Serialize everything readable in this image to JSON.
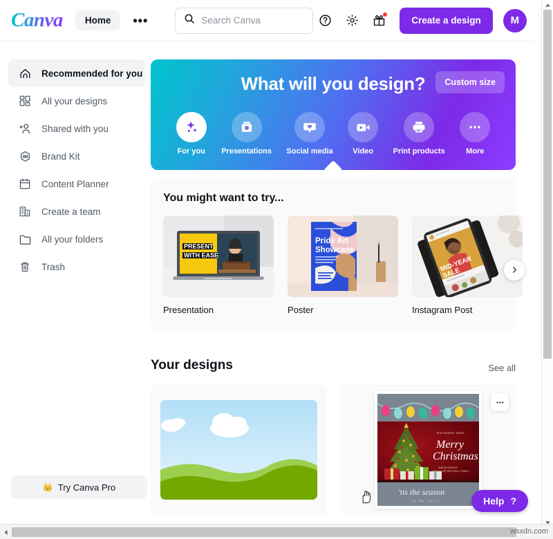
{
  "app": {
    "brand": "Canva",
    "avatar_initial": "M"
  },
  "header": {
    "home_label": "Home",
    "more_label": "•••",
    "search": {
      "placeholder": "Search Canva",
      "value": "",
      "icon": "search-icon"
    },
    "help_icon": "question-circle-icon",
    "settings_icon": "gear-icon",
    "gift_icon": "gift-icon",
    "create_button": "Create a design",
    "accent_color": "#7d2ae8"
  },
  "sidebar": {
    "items": [
      {
        "label": "Recommended for you",
        "icon": "home-icon",
        "active": true
      },
      {
        "label": "All your designs",
        "icon": "grid-icon",
        "active": false
      },
      {
        "label": "Shared with you",
        "icon": "add-person-icon",
        "active": false
      },
      {
        "label": "Brand Kit",
        "icon": "brand-hexagon-icon",
        "active": false
      },
      {
        "label": "Content Planner",
        "icon": "calendar-icon",
        "active": false
      },
      {
        "label": "Create a team",
        "icon": "building-icon",
        "active": false
      },
      {
        "label": "All your folders",
        "icon": "folder-icon",
        "active": false
      },
      {
        "label": "Trash",
        "icon": "trash-icon",
        "active": false
      }
    ],
    "pro_button": {
      "label": "Try Canva Pro",
      "icon": "crown-icon"
    }
  },
  "hero": {
    "title": "What will you design?",
    "custom_size_label": "Custom size",
    "gradient_from": "#00c4cc",
    "gradient_to": "#8b3dff",
    "categories": [
      {
        "label": "For you",
        "icon": "sparkle-icon",
        "selected": true
      },
      {
        "label": "Presentations",
        "icon": "presentation-icon",
        "selected": false
      },
      {
        "label": "Social media",
        "icon": "heart-bubble-icon",
        "selected": false
      },
      {
        "label": "Video",
        "icon": "video-camera-icon",
        "selected": false
      },
      {
        "label": "Print products",
        "icon": "printer-icon",
        "selected": false
      },
      {
        "label": "More",
        "icon": "ellipsis-icon",
        "selected": false
      }
    ]
  },
  "try_section": {
    "title": "You might want to try...",
    "next_icon": "chevron-right-icon",
    "cards": [
      {
        "name": "Presentation",
        "thumb_text_1": "PRESENT",
        "thumb_text_2": "WITH EASE"
      },
      {
        "name": "Poster",
        "thumb_text_1": "Pride Art",
        "thumb_text_2": "Showcase"
      },
      {
        "name": "Instagram Post",
        "thumb_text_1": "MID-YEAR",
        "thumb_text_2": "SALE"
      }
    ]
  },
  "designs_section": {
    "title": "Your designs",
    "see_all_label": "See all",
    "more_icon": "ellipsis-icon",
    "cards": [
      {
        "kind": "landscape",
        "name": ""
      },
      {
        "kind": "christmas-card",
        "date": "December 2021",
        "line1": "Merry",
        "line2": "Christmas!",
        "sub1": "WARM WISHES",
        "sub2": "FROM THE MITCHELL FAMILY",
        "footer1": "'tis the season",
        "footer2": "TO BE JOLLY"
      }
    ]
  },
  "help_fab": {
    "label": "Help",
    "icon": "question-mark-icon"
  },
  "watermark": {
    "text": "wsxdn.com"
  },
  "scrollbars": {
    "vertical_icon": "triangle-icon",
    "horizontal_icon": "triangle-icon"
  }
}
